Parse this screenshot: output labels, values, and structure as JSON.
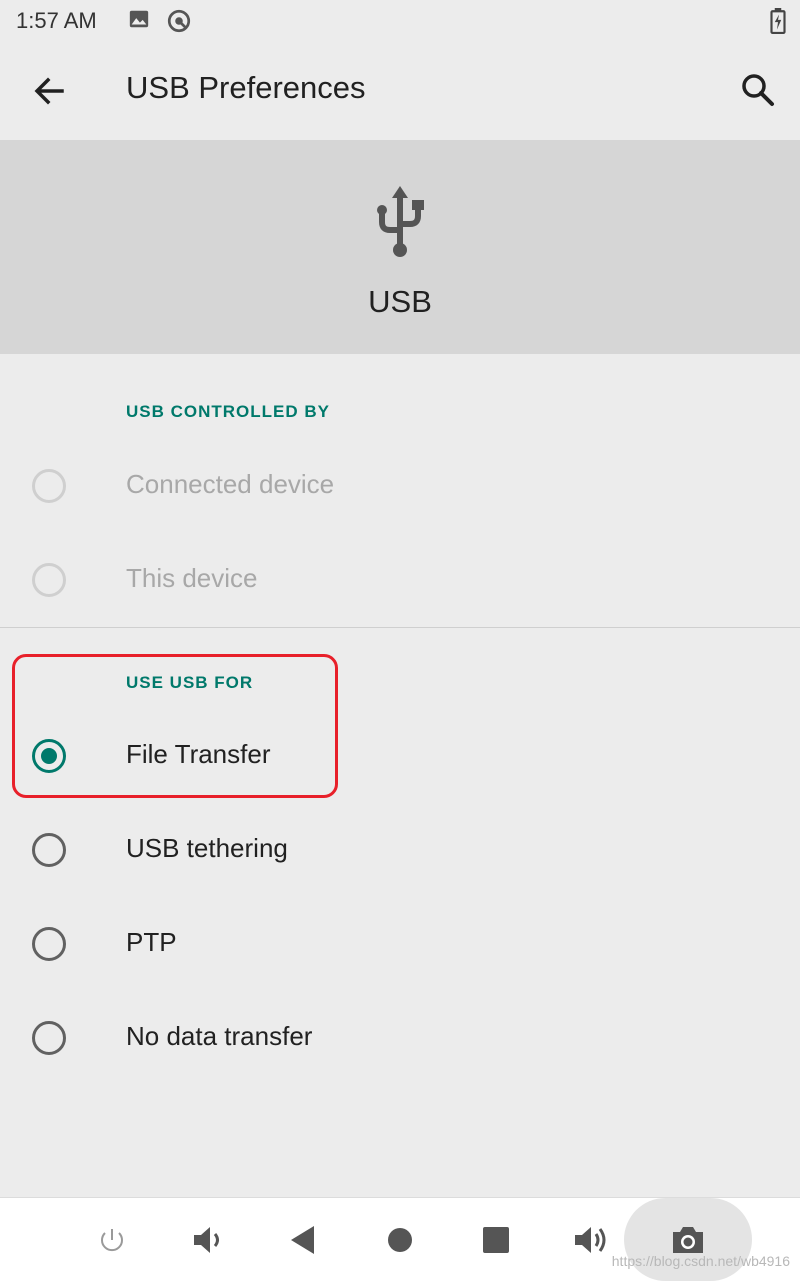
{
  "status_bar": {
    "time": "1:57 AM",
    "icons": [
      "image-icon",
      "location-icon",
      "battery-charging-icon"
    ]
  },
  "app_bar": {
    "title": "USB Preferences",
    "back_icon": "back-arrow-icon",
    "search_icon": "search-icon"
  },
  "header": {
    "icon": "usb-icon",
    "title": "USB"
  },
  "sections": {
    "controlled_by": {
      "label": "USB CONTROLLED BY",
      "options": [
        {
          "label": "Connected device",
          "checked": false,
          "enabled": false
        },
        {
          "label": "This device",
          "checked": false,
          "enabled": false
        }
      ]
    },
    "use_usb_for": {
      "label": "USE USB FOR",
      "options": [
        {
          "label": "File Transfer",
          "checked": true,
          "enabled": true
        },
        {
          "label": "USB tethering",
          "checked": false,
          "enabled": true
        },
        {
          "label": "PTP",
          "checked": false,
          "enabled": true
        },
        {
          "label": "No data transfer",
          "checked": false,
          "enabled": true
        }
      ]
    }
  },
  "nav_bar": {
    "buttons": [
      "power-icon",
      "volume-down-icon",
      "back-triangle-icon",
      "home-circle-icon",
      "recents-square-icon",
      "volume-up-icon",
      "camera-icon"
    ]
  },
  "watermark": "https://blog.csdn.net/wb4916",
  "colors": {
    "accent": "#00796b",
    "annotation": "#e8202a",
    "header_band": "#d6d6d6",
    "background": "#ececec"
  }
}
